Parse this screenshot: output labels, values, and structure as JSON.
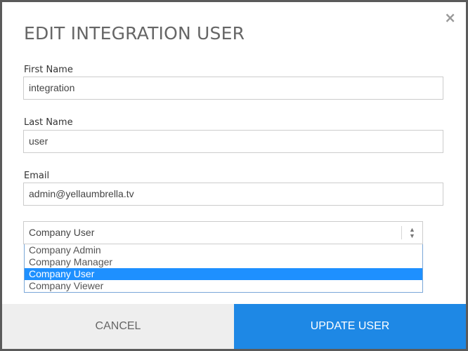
{
  "modal": {
    "title": "EDIT INTEGRATION USER",
    "close_glyph": "×"
  },
  "form": {
    "first_name": {
      "label": "First Name",
      "value": "integration"
    },
    "last_name": {
      "label": "Last Name",
      "value": "user"
    },
    "email": {
      "label": "Email",
      "value": "admin@yellaumbrella.tv"
    },
    "role": {
      "selected": "Company User",
      "options": [
        "Company Admin",
        "Company Manager",
        "Company User",
        "Company Viewer"
      ],
      "highlighted_index": 2
    }
  },
  "footer": {
    "cancel_label": "CANCEL",
    "update_label": "UPDATE USER"
  },
  "colors": {
    "primary": "#1e88e5",
    "highlight": "#1e90ff",
    "cancel_bg": "#eeeeee"
  },
  "icons": {
    "close": "close-icon",
    "select_arrow": "updown-arrow-icon"
  }
}
